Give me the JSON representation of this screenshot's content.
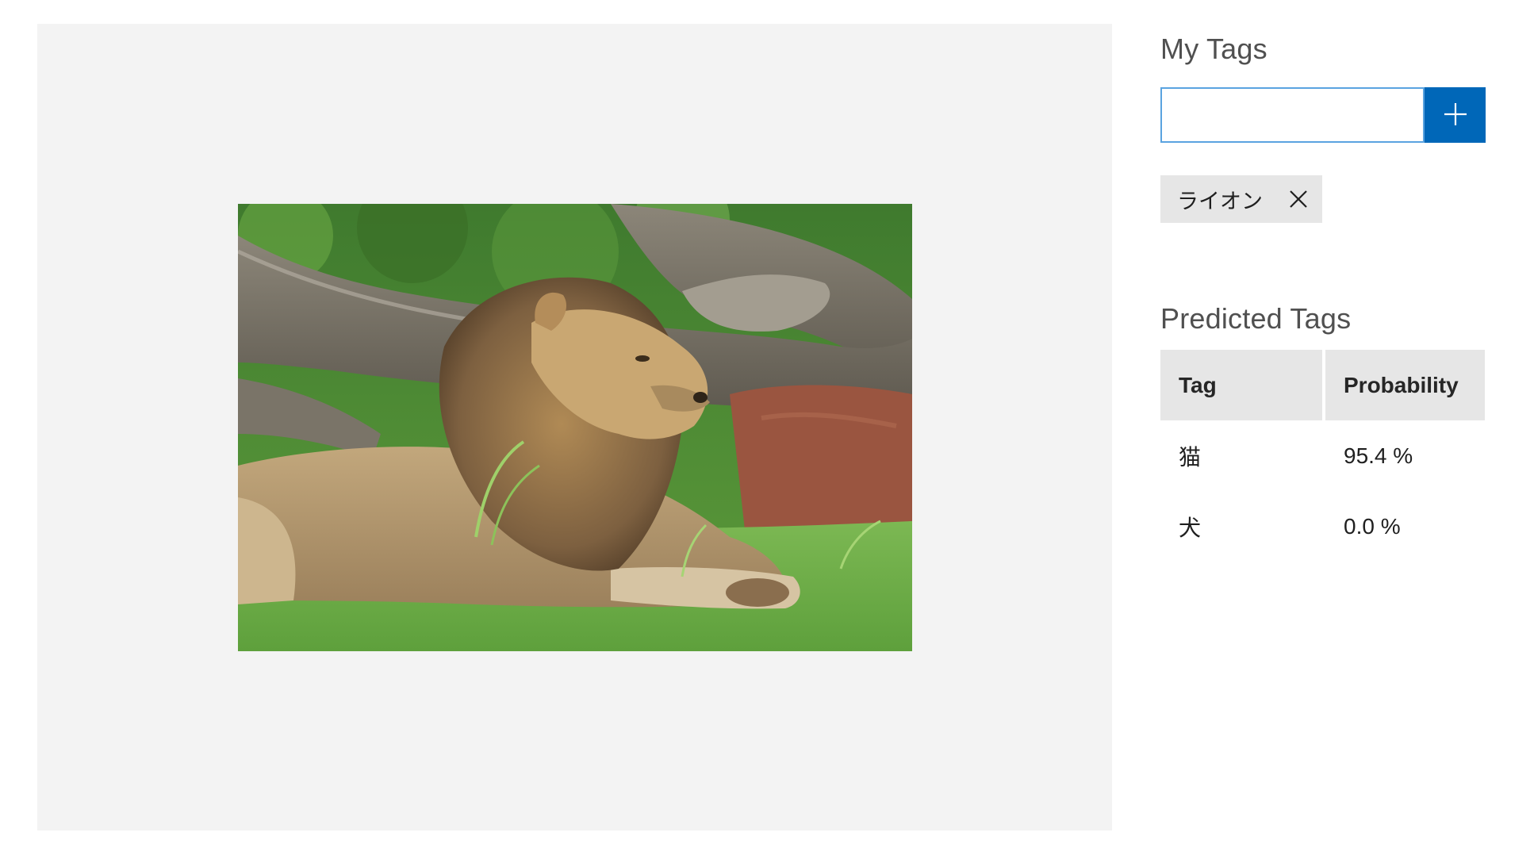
{
  "image_panel": {
    "photo_alt": "lion-photo"
  },
  "my_tags": {
    "title": "My Tags",
    "input_value": "",
    "input_placeholder": "",
    "add_icon": "plus-icon",
    "chips": [
      {
        "label": "ライオン",
        "remove_icon": "close-icon"
      }
    ]
  },
  "predicted_tags": {
    "title": "Predicted Tags",
    "headers": {
      "tag": "Tag",
      "probability": "Probability"
    },
    "rows": [
      {
        "tag": "猫",
        "probability": "95.4 %"
      },
      {
        "tag": "犬",
        "probability": "0.0 %"
      }
    ]
  },
  "colors": {
    "accent": "#0067b8",
    "input_border": "#5aa3e0",
    "panel_bg": "#f3f3f3",
    "chip_bg": "#e6e6e6",
    "header_bg": "#e6e6e6"
  }
}
